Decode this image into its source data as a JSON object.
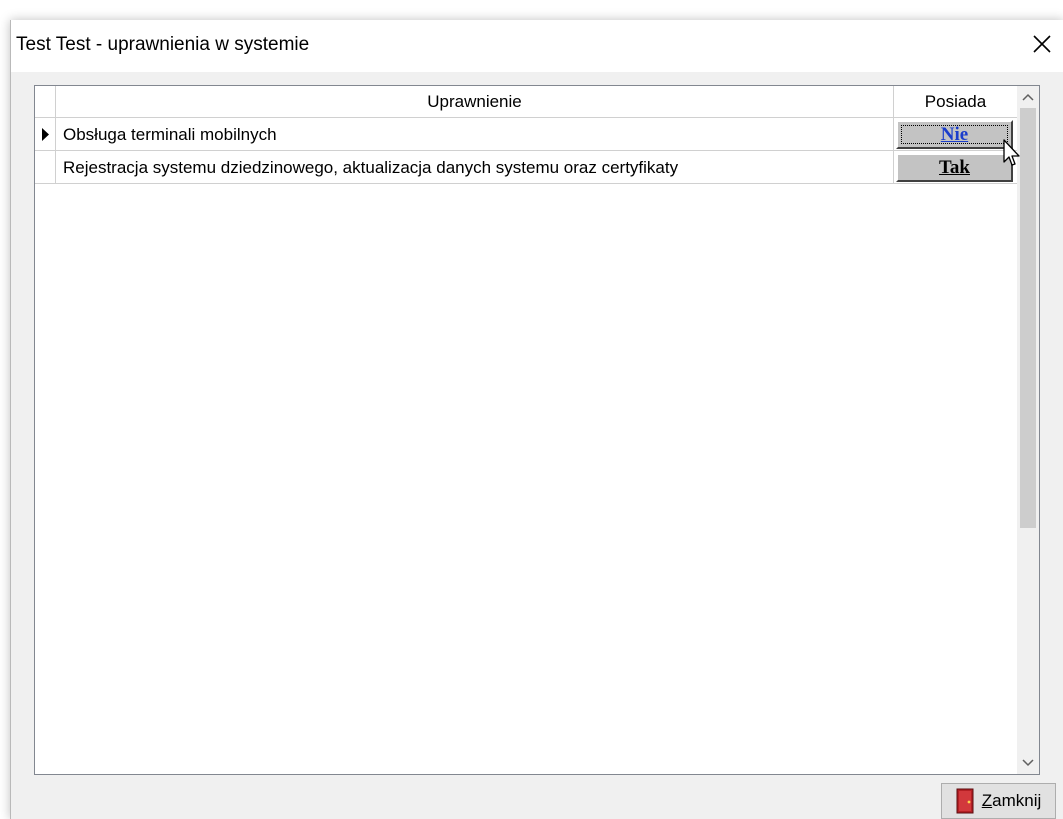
{
  "window": {
    "title": "Test Test - uprawnienia w systemie"
  },
  "grid": {
    "columns": [
      "Uprawnienie",
      "Posiada"
    ],
    "rows": [
      {
        "permission": "Obsługa terminali mobilnych",
        "has": "Nie",
        "current": true
      },
      {
        "permission": "Rejestracja systemu dziedzinowego, aktualizacja danych systemu oraz certyfikaty",
        "has": "Tak",
        "current": false
      }
    ]
  },
  "footer": {
    "close_label_mnemonic": "Z",
    "close_label_rest": "amknij"
  },
  "colors": {
    "focused_link": "#1a3dcc",
    "cell_button": "#c3c3c3",
    "door_icon": "#b41f24"
  },
  "icons": {
    "close": "close-icon",
    "current_row": "row-pointer-icon",
    "scroll_up": "chevron-up-icon",
    "scroll_down": "chevron-down-icon",
    "exit": "door-exit-icon",
    "cursor": "mouse-pointer-icon"
  }
}
